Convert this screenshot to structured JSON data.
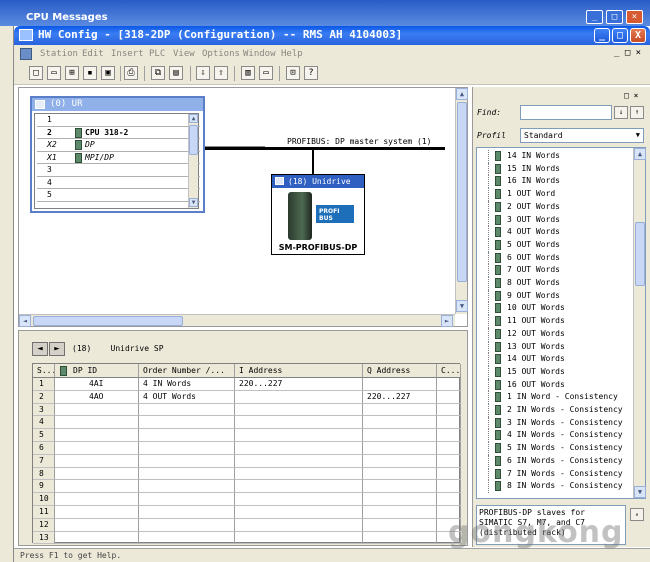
{
  "background_window": {
    "title": "CPU Messages"
  },
  "window": {
    "title": "HW Config - [318-2DP (Configuration) -- RMS AH 4104003]",
    "buttons": {
      "minimize": "_",
      "maximize": "□",
      "close": "X"
    }
  },
  "menu": [
    "Station",
    "Edit",
    "Insert",
    "PLC",
    "View",
    "Options",
    "Window",
    "Help"
  ],
  "rack": {
    "title": "(0) UR",
    "rows": [
      {
        "slot": "1",
        "module": ""
      },
      {
        "slot": "2",
        "module": "CPU 318-2"
      },
      {
        "slot": "X2",
        "module": "DP"
      },
      {
        "slot": "X1",
        "module": "MPI/DP"
      },
      {
        "slot": "3",
        "module": ""
      },
      {
        "slot": "4",
        "module": ""
      },
      {
        "slot": "5",
        "module": ""
      }
    ]
  },
  "bus": {
    "label": "PROFIBUS: DP master system (1)"
  },
  "device": {
    "title": "(18) Unidrive SP",
    "name": "SM-PROFIBUS-DP",
    "logo": "PROFI BUS"
  },
  "detail": {
    "nav_back": "◄",
    "nav_fwd": "►",
    "label": "(18)    Unidrive SP",
    "columns": [
      "S...",
      "DP ID",
      "Order Number /...",
      "I Address",
      "Q Address",
      "C..."
    ],
    "rows": [
      {
        "slot": "1",
        "dpid": "4AI",
        "order": "4 IN Words",
        "iaddr": "220...227",
        "qaddr": ""
      },
      {
        "slot": "2",
        "dpid": "4AO",
        "order": "4 OUT Words",
        "iaddr": "",
        "qaddr": "220...227"
      },
      {
        "slot": "3",
        "dpid": "",
        "order": "",
        "iaddr": "",
        "qaddr": ""
      },
      {
        "slot": "4",
        "dpid": "",
        "order": "",
        "iaddr": "",
        "qaddr": ""
      },
      {
        "slot": "5",
        "dpid": "",
        "order": "",
        "iaddr": "",
        "qaddr": ""
      },
      {
        "slot": "6",
        "dpid": "",
        "order": "",
        "iaddr": "",
        "qaddr": ""
      },
      {
        "slot": "7",
        "dpid": "",
        "order": "",
        "iaddr": "",
        "qaddr": ""
      },
      {
        "slot": "8",
        "dpid": "",
        "order": "",
        "iaddr": "",
        "qaddr": ""
      },
      {
        "slot": "9",
        "dpid": "",
        "order": "",
        "iaddr": "",
        "qaddr": ""
      },
      {
        "slot": "10",
        "dpid": "",
        "order": "",
        "iaddr": "",
        "qaddr": ""
      },
      {
        "slot": "11",
        "dpid": "",
        "order": "",
        "iaddr": "",
        "qaddr": ""
      },
      {
        "slot": "12",
        "dpid": "",
        "order": "",
        "iaddr": "",
        "qaddr": ""
      },
      {
        "slot": "13",
        "dpid": "",
        "order": "",
        "iaddr": "",
        "qaddr": ""
      }
    ]
  },
  "catalog": {
    "find_label": "Find:",
    "find_value": "",
    "profil_label": "Profil",
    "profil_value": "Standard",
    "items": [
      "14 IN Words",
      "15 IN Words",
      "16 IN Words",
      "1 OUT Word",
      "2 OUT Words",
      "3 OUT Words",
      "4 OUT Words",
      "5 OUT Words",
      "6 OUT Words",
      "7 OUT Words",
      "8 OUT Words",
      "9 OUT Words",
      "10 OUT Words",
      "11 OUT Words",
      "12 OUT Words",
      "13 OUT Words",
      "14 OUT Words",
      "15 OUT Words",
      "16 OUT Words",
      "1 IN Word - Consistency",
      "2 IN Words - Consistency",
      "3 IN Words - Consistency",
      "4 IN Words - Consistency",
      "5 IN Words - Consistency",
      "6 IN Words - Consistency",
      "7 IN Words - Consistency",
      "8 IN Words - Consistency"
    ],
    "description": "PROFIBUS-DP slaves for SIMATIC S7, M7, and C7 (distributed rack)"
  },
  "status": {
    "text": "Press F1 to get Help."
  },
  "watermark": "gongkong",
  "colors": {
    "titlebar": "#0a58e8",
    "chrome": "#ece9d8",
    "rack_border": "#5a7fc8"
  }
}
